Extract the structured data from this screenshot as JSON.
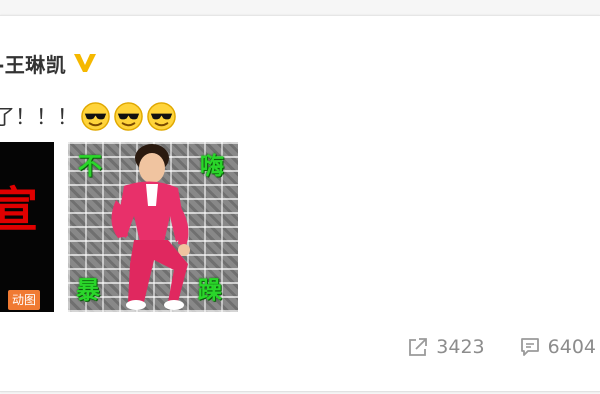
{
  "post": {
    "author": "-王琳凯",
    "text": "了！！！",
    "emoji_count": 3
  },
  "media": {
    "left_thumb_text": "宣",
    "gif_badge": "动图",
    "right_thumb_chars": [
      "不",
      "嗨",
      "暴",
      "躁"
    ]
  },
  "actions": {
    "share_count": "3423",
    "comment_count": "6404"
  },
  "colors": {
    "verified": "#f5b800",
    "gif_badge": "#f07a32",
    "sticker_text": "#2ad62a",
    "suit": "#e8306a"
  },
  "icons": {
    "verified": "verified-v-icon",
    "emoji": "cool-sunglasses-emoji-icon",
    "share": "share-icon",
    "comment": "comment-icon"
  }
}
